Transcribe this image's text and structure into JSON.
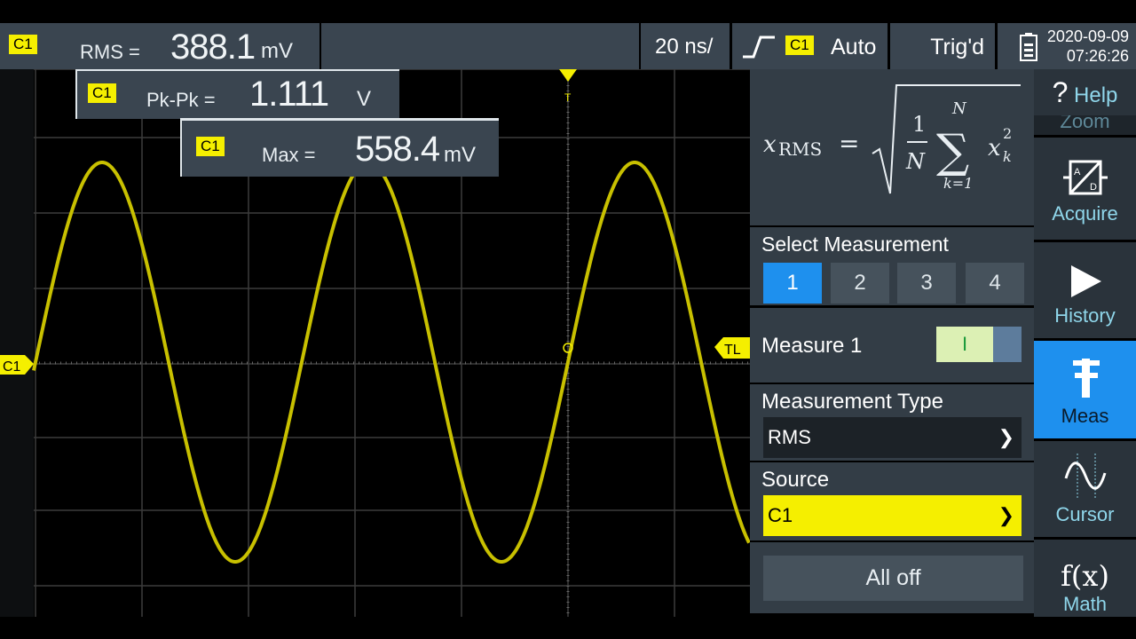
{
  "top": {
    "rms": {
      "ch": "C1",
      "label": "RMS =",
      "value": "388.1",
      "unit": "mV"
    },
    "timebase": "20 ns/",
    "trigger": {
      "ch": "C1",
      "mode": "Auto",
      "icon": "rising-edge-icon"
    },
    "status": "Trig'd",
    "date": "2020-09-09",
    "time": "07:26:26"
  },
  "overlays": [
    {
      "ch": "C1",
      "label": "Pk-Pk =",
      "value": "1.111",
      "unit": "V"
    },
    {
      "ch": "C1",
      "label": "Max =",
      "value": "558.4",
      "unit": "mV"
    }
  ],
  "markers": {
    "channel": "C1",
    "trigger_level": "TL",
    "trigger_pos": "T"
  },
  "trace_color": "#c8c000",
  "panel": {
    "select_label": "Select Measurement",
    "options": [
      "1",
      "2",
      "3",
      "4"
    ],
    "selected": "1",
    "measure_label": "Measure 1",
    "measure_on": true,
    "toggle_text": "I",
    "type_label": "Measurement Type",
    "type_value": "RMS",
    "source_label": "Source",
    "source_value": "C1",
    "all_off": "All off"
  },
  "sidebar": {
    "help": "Help",
    "zoom": "Zoom",
    "items": [
      "Acquire",
      "History",
      "Meas",
      "Cursor",
      "Math"
    ],
    "active": "Meas",
    "fx": "f(x)"
  }
}
